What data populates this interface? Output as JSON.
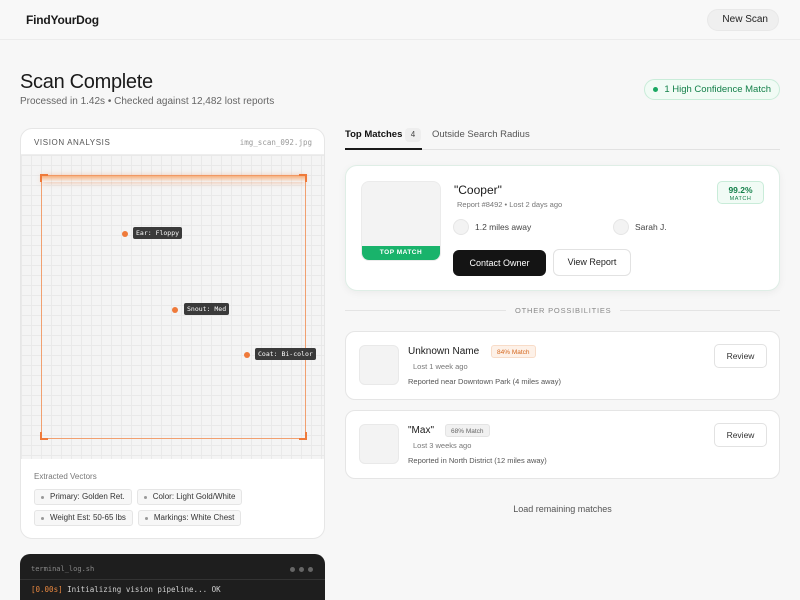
{
  "header": {
    "logo": "FindYourDog",
    "new_scan_label": "New Scan"
  },
  "summary": {
    "title": "Scan Complete",
    "subtitle": "Processed in 1.42s • Checked against 12,482 lost reports",
    "confidence_badge": "1 High Confidence Match"
  },
  "vision": {
    "title": "VISION ANALYSIS",
    "filename": "img_scan_092.jpg",
    "tags": [
      "Ear: Floppy",
      "Snout: Med",
      "Coat: Bi-color"
    ],
    "vectors_label": "Extracted Vectors",
    "chips": [
      "Primary: Golden Ret.",
      "Color: Light Gold/White",
      "Weight Est: 50-65 lbs",
      "Markings: White Chest"
    ]
  },
  "terminal": {
    "title": "terminal_log.sh",
    "line_ts": "[0.00s]",
    "line_text": " Initializing vision pipeline... OK"
  },
  "tabs": {
    "top_matches": "Top Matches",
    "top_matches_count": "4",
    "outside": "Outside Search Radius"
  },
  "top_match": {
    "badge": "TOP MATCH",
    "name": "\"Cooper\"",
    "meta": "Report #8492 • Lost 2 days ago",
    "score": "99.2%",
    "score_label": "MATCH",
    "distance": "1.2 miles away",
    "owner": "Sarah J.",
    "contact_label": "Contact Owner",
    "report_label": "View Report"
  },
  "divider_label": "OTHER POSSIBILITIES",
  "others": [
    {
      "name": "Unknown Name",
      "match": "84% Match",
      "lost": "Lost 1 week ago",
      "where": "Reported near Downtown Park (4 miles away)",
      "review": "Review"
    },
    {
      "name": "\"Max\"",
      "match": "68% Match",
      "lost": "Lost 3 weeks ago",
      "where": "Reported in North District (12 miles away)",
      "review": "Review"
    }
  ],
  "load_more": "Load remaining matches",
  "colors": {
    "accent_orange": "#ef7a3a",
    "success_green": "#19b36b",
    "dark": "#141414"
  }
}
